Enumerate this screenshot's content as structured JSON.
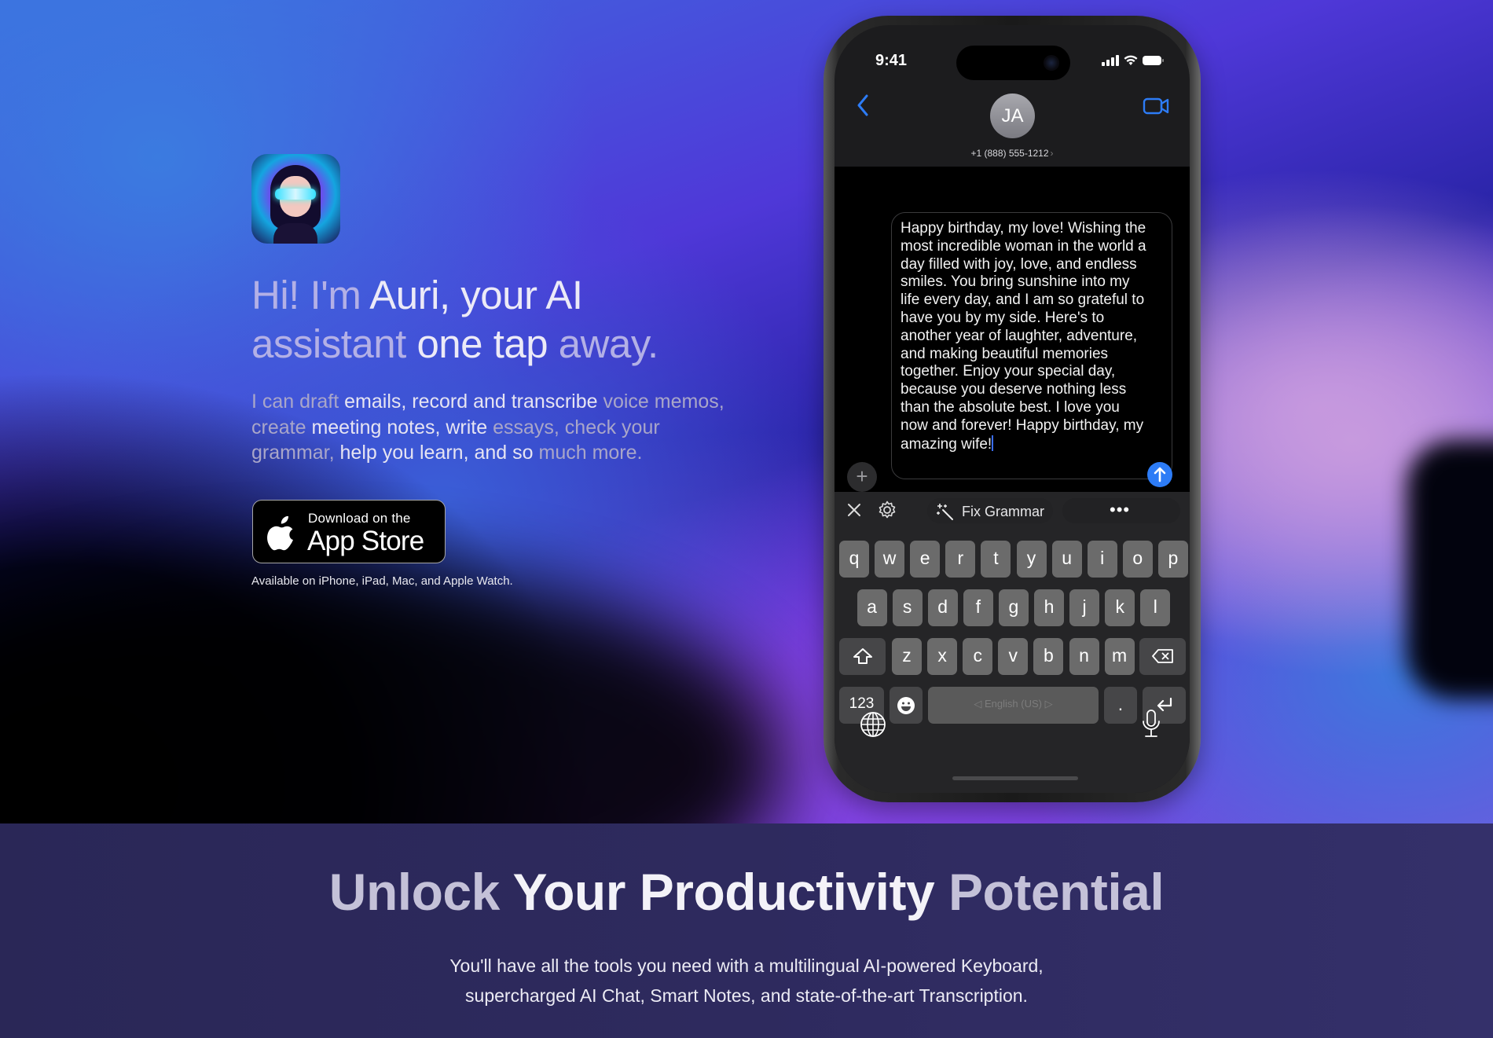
{
  "hero": {
    "app_icon_alt": "Auri app icon",
    "headline": {
      "part1_dim": "Hi! I'm ",
      "part2_bright": "Auri, your AI",
      "part3_dim": "assistant ",
      "part4_bright": "one tap ",
      "part5_dim": "away."
    },
    "lead": {
      "p1_dim": "I can ",
      "p2_dim": "draft ",
      "p3_bright": "emails, record and transcribe ",
      "p4_dim": "voice memos, ",
      "p5_dim": "create ",
      "p6_bright": "meeting notes, write ",
      "p7_dim": "essays, check your ",
      "p8_dim": "grammar, ",
      "p9_bright": "help you learn, and so ",
      "p10_dim": "much more."
    },
    "appstore_button": {
      "small_label": "Download on the",
      "big_label": "App Store"
    },
    "availability": "Available on iPhone, iPad, Mac, and Apple Watch."
  },
  "phone": {
    "status_time": "9:41",
    "contact_initials": "JA",
    "contact_number": "+1 (888) 555-1212",
    "compose_text": "Happy birthday, my love! Wishing the most incredible woman in the world a day filled with joy, love, and endless smiles. You bring sunshine into my life every day, and I am so grateful to have you by my side. Here's to another year of laughter, adventure, and making beautiful memories together. Enjoy your special day, because you deserve nothing less than the absolute best. I love you now and forever! Happy birthday, my amazing wife!",
    "toolbar": {
      "fix_grammar_label": "Fix Grammar",
      "more_label": "•••"
    },
    "keyboard": {
      "row1": [
        "q",
        "w",
        "e",
        "r",
        "t",
        "y",
        "u",
        "i",
        "o",
        "p"
      ],
      "row2": [
        "a",
        "s",
        "d",
        "f",
        "g",
        "h",
        "j",
        "k",
        "l"
      ],
      "row3": [
        "z",
        "x",
        "c",
        "v",
        "b",
        "n",
        "m"
      ],
      "numbers_label": "123",
      "space_label": "◁ English (US) ▷",
      "period_label": "."
    },
    "accent_color": "#2d7cf6"
  },
  "lower": {
    "title_dim1": "Unlock ",
    "title_bright": "Your Productivity ",
    "title_dim2": "Potential",
    "subtitle_line1": "You'll have all the tools you need with a multilingual AI-powered Keyboard,",
    "subtitle_line2": "supercharged AI Chat, Smart Notes, and state-of-the-art Transcription."
  }
}
